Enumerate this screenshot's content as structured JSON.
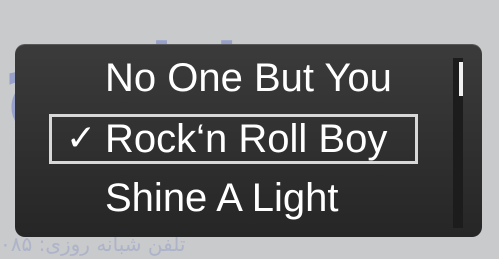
{
  "menu": {
    "items": [
      {
        "label": "No One But You",
        "selected": false
      },
      {
        "label": "Rock‘n Roll Boy",
        "selected": true
      },
      {
        "label": "Shine A Light",
        "selected": false
      }
    ],
    "check_glyph": "✓",
    "scroll_position": 0
  },
  "watermark": {
    "logo_text": "اداروح",
    "phone_text": "تلفن شبانه روزی: ۰۸۵"
  },
  "colors": {
    "background": "#c9cacb",
    "menu_background": "#2f2f2f",
    "text": "#ffffff",
    "selection_border": "#d8d8d8",
    "watermark": "#3a55c8"
  }
}
